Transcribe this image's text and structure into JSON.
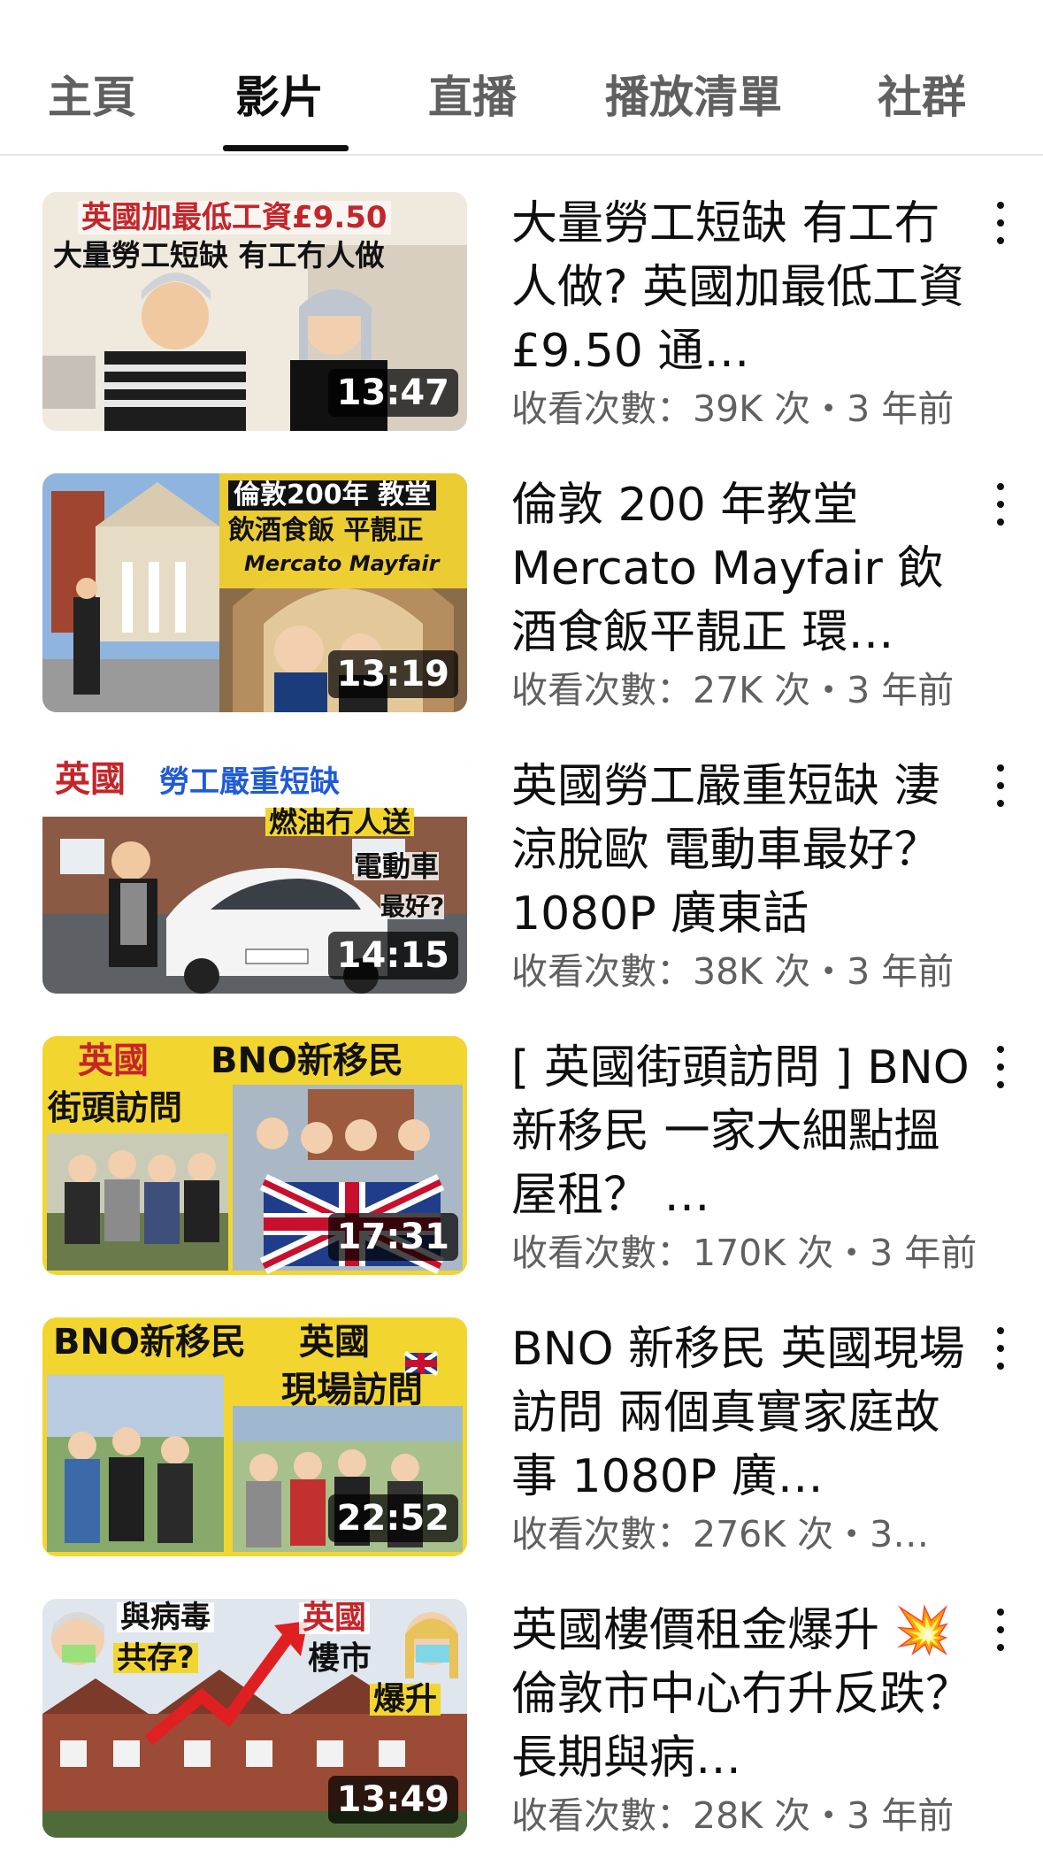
{
  "tabs": [
    {
      "label": "主頁"
    },
    {
      "label": "影片"
    },
    {
      "label": "直播"
    },
    {
      "label": "播放清單"
    },
    {
      "label": "社群"
    }
  ],
  "active_tab": "影片",
  "videos": [
    {
      "title": "大量勞工短缺 有工冇人做? 英國加最低工資 £9.50 通…",
      "meta": "收看次數：39K 次・3 年前",
      "duration": "13:47",
      "thumb_text": [
        "英國加最低工資£9.50",
        "大量勞工短缺 有工冇人做"
      ]
    },
    {
      "title": "倫敦 200 年教堂 Mercato Mayfair 飲酒食飯平靚正 環…",
      "meta": "收看次數：27K 次・3 年前",
      "duration": "13:19",
      "thumb_text": [
        "倫敦200年 教堂",
        "飲酒食飯 平靚正",
        "Mercato Mayfair"
      ]
    },
    {
      "title": "英國勞工嚴重短缺 淒涼脫歐 電動車最好？1080P 廣東話",
      "meta": "收看次數：38K 次・3 年前",
      "duration": "14:15",
      "thumb_text": [
        "英國",
        "勞工嚴重短缺",
        "燃油冇人送",
        "電動車",
        "最好?"
      ]
    },
    {
      "title": "[ 英國街頭訪問 ] BNO 新移民 一家大細點搵屋租？ …",
      "meta": "收看次數：170K 次・3 年前",
      "duration": "17:31",
      "thumb_text": [
        "英國",
        "BNO新移民",
        "街頭訪問"
      ]
    },
    {
      "title": "BNO 新移民 英國現場訪問 兩個真實家庭故事 1080P 廣…",
      "meta": "收看次數：276K 次・3…",
      "duration": "22:52",
      "thumb_text": [
        "BNO新移民",
        "英國",
        "現場訪問"
      ]
    },
    {
      "title": "英國樓價租金爆升 💥 倫敦市中心冇升反跌？長期與病…",
      "meta": "收看次數：28K 次・3 年前",
      "duration": "13:49",
      "thumb_text": [
        "與病毒",
        "共存?",
        "英國",
        "樓市",
        "爆升"
      ]
    }
  ]
}
